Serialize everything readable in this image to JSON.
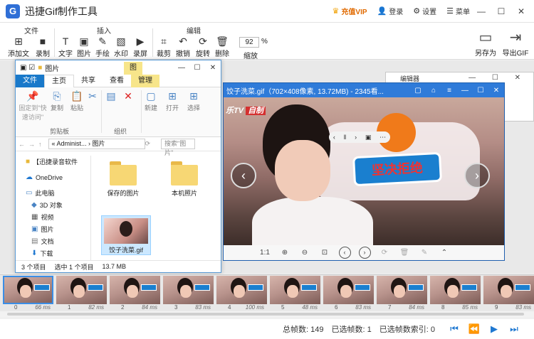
{
  "app": {
    "logo_letter": "G",
    "title": "迅捷Gif制作工具",
    "vip_label": "充值VIP",
    "login_label": "登录",
    "settings_label": "设置",
    "menu_label": "菜单",
    "minimize": "—",
    "maximize": "☐",
    "close": "✕"
  },
  "ribbon": {
    "groups": {
      "file": "文件",
      "insert": "插入",
      "edit": "编辑"
    },
    "buttons": {
      "add_file": "添加文件",
      "record": "录制",
      "text": "文字",
      "image": "图片",
      "handwriting": "手绘",
      "watermark": "水印",
      "screen_record": "录屏",
      "crop": "裁剪",
      "undo": "撤销",
      "rotate": "旋转",
      "delete": "删除",
      "zoom_value": "92",
      "zoom_unit": "%",
      "zoom": "缩放",
      "save_as": "另存为",
      "export_gif": "导出GIF"
    }
  },
  "explorer": {
    "title": "图片",
    "tool_tab": "图",
    "tabs": {
      "file": "文件",
      "home": "主页",
      "share": "共享",
      "view": "查看",
      "manage": "管理"
    },
    "ribbon": {
      "pin": "固定到\"快\n速访问\"",
      "copy": "复制",
      "paste": "粘贴",
      "clipboard": "剪贴板",
      "organize": "组织",
      "new": "新建",
      "open": "打开",
      "select": "选择"
    },
    "address": {
      "path": "«  Administ... › 图片",
      "search": "搜索\"图片\""
    },
    "nav": [
      "【迅捷录音软件",
      "OneDrive",
      "此电脑",
      "3D 对象",
      "视频",
      "图片",
      "文档",
      "下载",
      "音乐"
    ],
    "files": [
      "保存的图片",
      "本机照片",
      "饺子洗菜.gif"
    ],
    "status": {
      "count": "3 个项目",
      "selected": "选中 1 个项目",
      "size": "13.7 MB"
    }
  },
  "editor": {
    "title": "编辑器"
  },
  "viewer": {
    "title": "饺子洗菜.gif（702×408像素, 13.72MB) - 2345看...",
    "logo": "乐TV",
    "logo_tag": "自制",
    "caption": "坚决拒绝",
    "ratio_label": "1:1"
  },
  "filmstrip": {
    "frames": [
      {
        "index": "0",
        "ms": "66 ms"
      },
      {
        "index": "1",
        "ms": "82 ms"
      },
      {
        "index": "2",
        "ms": "84 ms"
      },
      {
        "index": "3",
        "ms": "83 ms"
      },
      {
        "index": "4",
        "ms": "100 ms"
      },
      {
        "index": "5",
        "ms": "48 ms"
      },
      {
        "index": "6",
        "ms": "83 ms"
      },
      {
        "index": "7",
        "ms": "84 ms"
      },
      {
        "index": "8",
        "ms": "85 ms"
      },
      {
        "index": "9",
        "ms": "83 ms"
      }
    ]
  },
  "status": {
    "total_frames": "总帧数: 149",
    "selected_frames": "已选帧数: 1",
    "selected_index": "已选帧数索引: 0"
  }
}
